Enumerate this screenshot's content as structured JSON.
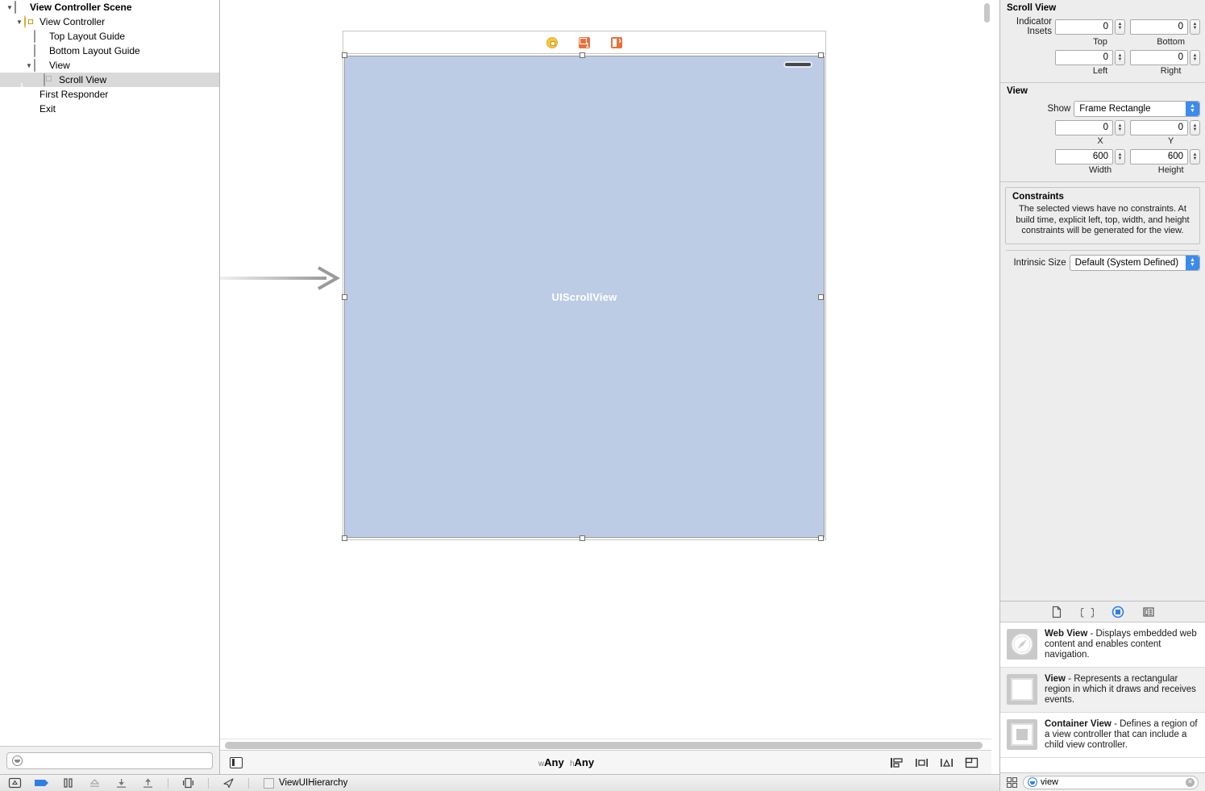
{
  "outline": {
    "items": [
      {
        "label": "View Controller Scene",
        "icon": "scene-icon",
        "depth": 0,
        "disclosure": "open",
        "bold": true,
        "selected": false
      },
      {
        "label": "View Controller",
        "icon": "view-controller-icon",
        "depth": 1,
        "disclosure": "open",
        "bold": false,
        "selected": false
      },
      {
        "label": "Top Layout Guide",
        "icon": "top-layout-guide-icon",
        "depth": 2,
        "disclosure": "none",
        "bold": false,
        "selected": false
      },
      {
        "label": "Bottom Layout Guide",
        "icon": "bottom-layout-guide-icon",
        "depth": 2,
        "disclosure": "none",
        "bold": false,
        "selected": false
      },
      {
        "label": "View",
        "icon": "view-icon",
        "depth": 2,
        "disclosure": "open",
        "bold": false,
        "selected": false
      },
      {
        "label": "Scroll View",
        "icon": "scroll-view-icon",
        "depth": 3,
        "disclosure": "none",
        "bold": false,
        "selected": true
      },
      {
        "label": "First Responder",
        "icon": "first-responder-icon",
        "depth": 1,
        "disclosure": "none",
        "bold": false,
        "selected": false
      },
      {
        "label": "Exit",
        "icon": "exit-icon",
        "depth": 1,
        "disclosure": "none",
        "bold": false,
        "selected": false
      }
    ],
    "filter_placeholder": ""
  },
  "canvas": {
    "scene_header_icons": [
      "view-controller-icon",
      "first-responder-icon",
      "exit-icon"
    ],
    "scrollview_label": "UIScrollView",
    "scrollview_color": "#bdcce5",
    "size_class": {
      "width_prefix": "w",
      "width_value": "Any",
      "height_prefix": "h",
      "height_value": "Any"
    }
  },
  "inspector": {
    "scroll_view": {
      "title": "Scroll View",
      "indicator_insets_label": "Indicator Insets",
      "fields": [
        {
          "sub": "Top",
          "value": "0"
        },
        {
          "sub": "Bottom",
          "value": "0"
        },
        {
          "sub": "Left",
          "value": "0"
        },
        {
          "sub": "Right",
          "value": "0"
        }
      ]
    },
    "view": {
      "title": "View",
      "show_label": "Show",
      "show_value": "Frame Rectangle",
      "fields": [
        {
          "sub": "X",
          "value": "0"
        },
        {
          "sub": "Y",
          "value": "0"
        },
        {
          "sub": "Width",
          "value": "600"
        },
        {
          "sub": "Height",
          "value": "600"
        }
      ]
    },
    "constraints": {
      "title": "Constraints",
      "description": "The selected views have no constraints. At build time, explicit left, top, width, and height constraints will be generated for the view.",
      "intrinsic_label": "Intrinsic Size",
      "intrinsic_value": "Default (System Defined)"
    }
  },
  "library": {
    "tabs": [
      {
        "name": "file-template-library-tab",
        "selected": false
      },
      {
        "name": "code-snippet-library-tab",
        "selected": false
      },
      {
        "name": "object-library-tab",
        "selected": true
      },
      {
        "name": "media-library-tab",
        "selected": false
      }
    ],
    "items": [
      {
        "title": "Web View",
        "desc": " - Displays embedded web content and enables content navigation.",
        "icon": "web-view-icon"
      },
      {
        "title": "View",
        "desc": " - Represents a rectangular region in which it draws and receives events.",
        "icon": "view-object-icon"
      },
      {
        "title": "Container View",
        "desc": " - Defines a region of a view controller that can include a child view controller.",
        "icon": "container-view-icon"
      }
    ],
    "filter_token": "view",
    "accent_color": "#2f7fe5"
  },
  "bottombar": {
    "breadcrumb": "ViewUIHierarchy",
    "icons": [
      "show-debug-area-icon",
      "breakpoints-icon",
      "pause-icon",
      "step-over-icon",
      "step-into-icon",
      "step-out-icon",
      "view-debugger-icon",
      "location-simulate-icon"
    ]
  }
}
